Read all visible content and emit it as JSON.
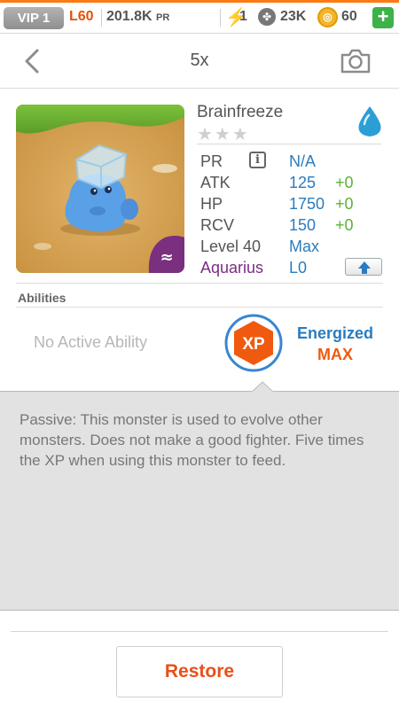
{
  "status_bar": {
    "vip": "VIP 1",
    "level": "L60",
    "power": "201.8K",
    "power_unit": "PR",
    "energy_count": "1",
    "paw_count": "23K",
    "gold_count": "60",
    "plus": "+",
    "accent_color": "#ff7a12"
  },
  "header": {
    "title": "5x",
    "back_icon": "chevron-left-icon",
    "camera_icon": "camera-icon"
  },
  "monster": {
    "name": "Brainfreeze",
    "stars": "★★★",
    "element_icon": "water-drop-icon",
    "element_color": "#2a9fd6",
    "stats": {
      "pr_label": "PR",
      "pr_value": "N/A",
      "atk_label": "ATK",
      "atk_value": "125",
      "atk_bonus": "+0",
      "hp_label": "HP",
      "hp_value": "1750",
      "hp_bonus": "+0",
      "rcv_label": "RCV",
      "rcv_value": "150",
      "rcv_bonus": "+0",
      "level_label": "Level 40",
      "level_value": "Max",
      "sign_label": "Aquarius",
      "sign_value": "L0"
    },
    "value_color": "#2a7cc0",
    "bonus_color": "#5bb236"
  },
  "abilities": {
    "title": "Abilities",
    "active": "No Active Ability",
    "badge": "XP",
    "passive_name": "Energized",
    "passive_level": "MAX"
  },
  "description": "Passive: This monster is used to evolve other monsters. Does not make a good fighter. Five times the XP when using this monster to feed.",
  "footer": {
    "restore_label": "Restore"
  }
}
